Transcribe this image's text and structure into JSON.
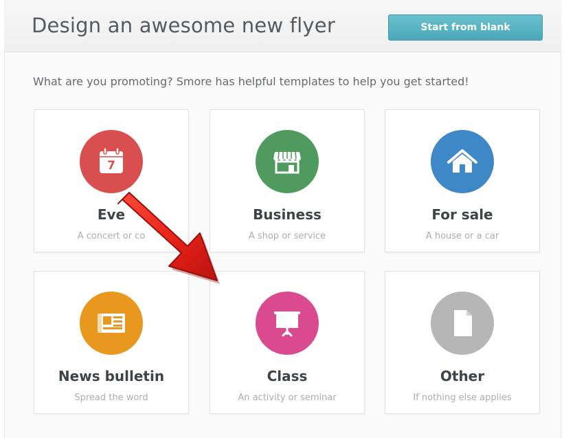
{
  "header": {
    "title": "Design an awesome new flyer",
    "start_blank_label": "Start from blank"
  },
  "prompt": "What are you promoting? Smore has helpful templates to help you get started!",
  "colors": {
    "event": "#d94f4f",
    "business": "#4f9a5f",
    "for_sale": "#3f88c8",
    "news": "#e8971f",
    "class": "#d94a8e",
    "other": "#b6b6b6",
    "button": "#55b2c0",
    "arrow": "#e8231c"
  },
  "cards": [
    {
      "title": "Eve",
      "subtitle": "A concert or co",
      "icon": "calendar-icon",
      "calendar_day": "7"
    },
    {
      "title": "Business",
      "subtitle": "A shop or service",
      "icon": "storefront-icon"
    },
    {
      "title": "For sale",
      "subtitle": "A house or a car",
      "icon": "house-icon"
    },
    {
      "title": "News bulletin",
      "subtitle": "Spread the word",
      "icon": "newspaper-icon"
    },
    {
      "title": "Class",
      "subtitle": "An activity or seminar",
      "icon": "presentation-board-icon"
    },
    {
      "title": "Other",
      "subtitle": "If nothing else applies",
      "icon": "document-icon"
    }
  ]
}
